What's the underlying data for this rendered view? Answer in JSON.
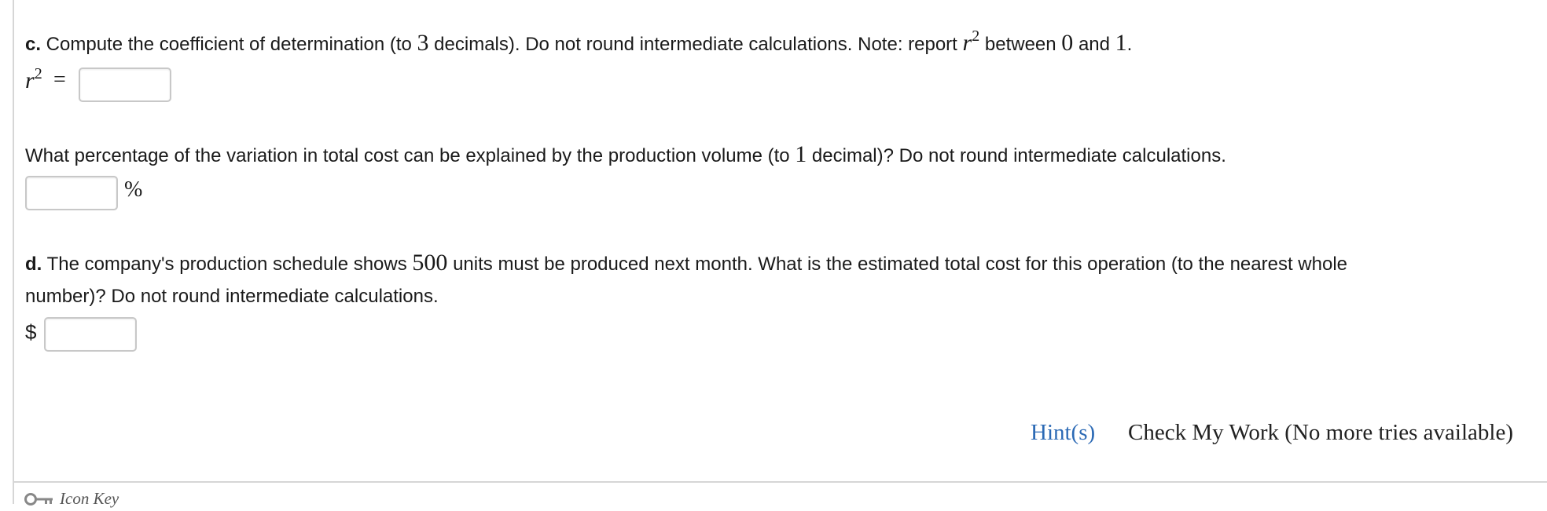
{
  "part_c": {
    "label": "c.",
    "text_1": " Compute the coefficient of determination (to ",
    "num_decimals": "3",
    "text_2": " decimals). Do not round intermediate calculations. Note: report ",
    "r_var": "r",
    "r_exp": "2",
    "text_3": " between ",
    "lower": "0",
    "text_4": " and ",
    "upper": "1",
    "text_5": ".",
    "answer_var": "r",
    "answer_exp": "2",
    "equals": "=",
    "answer_value": ""
  },
  "part_c2": {
    "text_1": "What percentage of the variation in total cost can be explained by the production volume (to ",
    "num_decimals": "1",
    "text_2": " decimal)? Do not round intermediate calculations.",
    "answer_value": "",
    "unit": "%"
  },
  "part_d": {
    "label": "d.",
    "text_1": " The company's production schedule shows ",
    "units": "500",
    "text_2": " units must be produced next month. What is the estimated total cost for this operation (to the nearest whole",
    "text_line2": "number)? Do not round intermediate calculations.",
    "currency": "$",
    "answer_value": ""
  },
  "footer": {
    "hint_label": "Hint(s)",
    "check_label": "Check My Work (No more tries available)",
    "icon_key_label": "Icon Key"
  },
  "colors": {
    "link_blue": "#2c6ab5",
    "border_gray": "#c8c8c8"
  }
}
